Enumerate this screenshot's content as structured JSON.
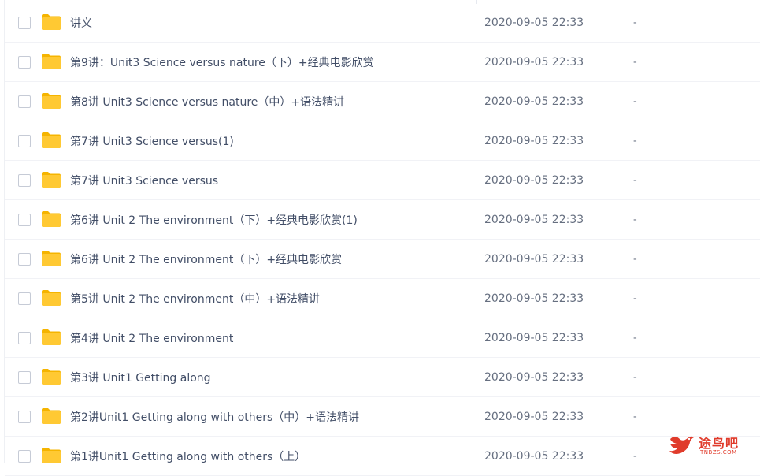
{
  "files": [
    {
      "name": "讲义",
      "date": "2020-09-05 22:33",
      "size": "-"
    },
    {
      "name": "第9讲：Unit3 Science versus nature（下）+经典电影欣赏",
      "date": "2020-09-05 22:33",
      "size": "-"
    },
    {
      "name": "第8讲 Unit3 Science versus nature（中）+语法精讲",
      "date": "2020-09-05 22:33",
      "size": "-"
    },
    {
      "name": "第7讲 Unit3 Science versus(1)",
      "date": "2020-09-05 22:33",
      "size": "-"
    },
    {
      "name": "第7讲 Unit3 Science versus",
      "date": "2020-09-05 22:33",
      "size": "-"
    },
    {
      "name": "第6讲 Unit 2 The environment（下）+经典电影欣赏(1)",
      "date": "2020-09-05 22:33",
      "size": "-"
    },
    {
      "name": "第6讲 Unit 2 The environment（下）+经典电影欣赏",
      "date": "2020-09-05 22:33",
      "size": "-"
    },
    {
      "name": "第5讲 Unit 2 The environment（中）+语法精讲",
      "date": "2020-09-05 22:33",
      "size": "-"
    },
    {
      "name": "第4讲 Unit 2 The environment",
      "date": "2020-09-05 22:33",
      "size": "-"
    },
    {
      "name": "第3讲 Unit1 Getting along",
      "date": "2020-09-05 22:33",
      "size": "-"
    },
    {
      "name": "第2讲Unit1 Getting along with others（中）+语法精讲",
      "date": "2020-09-05 22:33",
      "size": "-"
    },
    {
      "name": "第1讲Unit1 Getting along with others（上）",
      "date": "2020-09-05 22:33",
      "size": "-"
    }
  ],
  "watermark": {
    "text": "途鸟吧",
    "url": "TNBZS.COM"
  },
  "colors": {
    "folder": "#ffc933",
    "folder_tab": "#f5b400",
    "text": "#424e67",
    "muted": "#666f80",
    "watermark": "#e03b2b"
  },
  "icons": {
    "folder": "folder-icon",
    "checkbox": "checkbox-icon",
    "logo": "bird-logo-icon"
  }
}
